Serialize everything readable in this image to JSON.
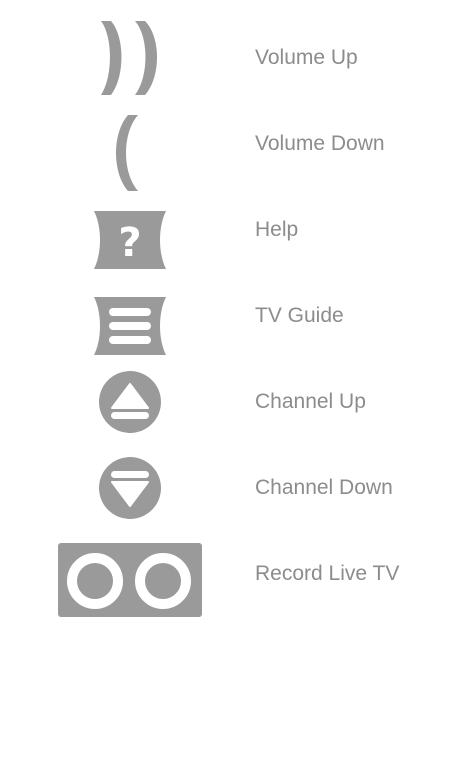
{
  "legend": {
    "items": [
      {
        "label": "Volume Up",
        "icon": "volume-up-icon"
      },
      {
        "label": "Volume Down",
        "icon": "volume-down-icon"
      },
      {
        "label": "Help",
        "icon": "help-icon"
      },
      {
        "label": "TV Guide",
        "icon": "tv-guide-icon"
      },
      {
        "label": "Channel Up",
        "icon": "channel-up-icon"
      },
      {
        "label": "Channel Down",
        "icon": "channel-down-icon"
      },
      {
        "label": "Record Live TV",
        "icon": "record-live-tv-icon"
      }
    ]
  },
  "colors": {
    "icon": "#9a9a9a",
    "icon_inner": "#ffffff",
    "label": "#8c8c8c",
    "background": "#ffffff"
  }
}
